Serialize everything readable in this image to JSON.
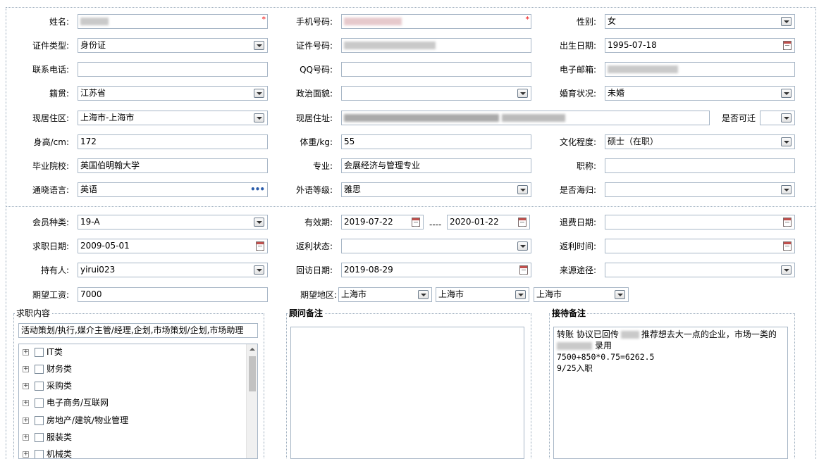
{
  "personal": {
    "name_label": "姓名:",
    "mobile_label": "手机号码:",
    "gender_label": "性别:",
    "gender_value": "女",
    "idtype_label": "证件类型:",
    "idtype_value": "身份证",
    "idno_label": "证件号码:",
    "birth_label": "出生日期:",
    "birth_value": "1995-07-18",
    "phone_label": "联系电话:",
    "qq_label": "QQ号码:",
    "email_label": "电子邮箱:",
    "native_label": "籍贯:",
    "native_value": "江苏省",
    "political_label": "政治面貌:",
    "marital_label": "婚育状况:",
    "marital_value": "未婚",
    "residence_label": "现居住区:",
    "residence_value": "上海市-上海市",
    "address_label": "现居住址:",
    "relocate_label": "是否可迁",
    "height_label": "身高/cm:",
    "height_value": "172",
    "weight_label": "体重/kg:",
    "weight_value": "55",
    "education_label": "文化程度:",
    "education_value": "硕士（在职）",
    "school_label": "毕业院校:",
    "school_value": "英国伯明翰大学",
    "major_label": "专业:",
    "major_value": "会展经济与管理专业",
    "title_label": "职称:",
    "language_label": "通晓语言:",
    "language_value": "英语",
    "forlevel_label": "外语等级:",
    "forlevel_value": "雅思",
    "overseas_label": "是否海归:"
  },
  "member": {
    "type_label": "会员种类:",
    "type_value": "19-A",
    "valid_label": "有效期:",
    "valid_from": "2019-07-22",
    "valid_sep": "----",
    "valid_to": "2020-01-22",
    "refund_date_label": "退费日期:",
    "job_date_label": "求职日期:",
    "job_date_value": "2009-05-01",
    "rebate_status_label": "返利状态:",
    "rebate_time_label": "返利时间:",
    "holder_label": "持有人:",
    "holder_value": "yirui023",
    "visit_date_label": "回访日期:",
    "visit_date_value": "2019-08-29",
    "source_label": "来源途径:",
    "salary_label": "期望工资:",
    "salary_value": "7000",
    "region_label": "期望地区:",
    "region_1": "上海市",
    "region_2": "上海市",
    "region_3": "上海市"
  },
  "job_content": {
    "title": "求职内容",
    "summary": "活动策划/执行,媒介主管/经理,企划,市场策划/企划,市场助理",
    "tree": [
      {
        "label": "IT类"
      },
      {
        "label": "财务类"
      },
      {
        "label": "采购类"
      },
      {
        "label": "电子商务/互联网"
      },
      {
        "label": "房地产/建筑/物业管理"
      },
      {
        "label": "服装类"
      },
      {
        "label": "机械类"
      }
    ],
    "expand_glyph": "+"
  },
  "advisor_note": {
    "title": "顾问备注",
    "text": ""
  },
  "reception_note": {
    "title": "接待备注",
    "line1a": "转账 协议已回传",
    "line1b": "推荐想去大一点的企业，市场一类的",
    "line2b": "录用",
    "line3": "7500+850*0.75=6262.5",
    "line4": "9/25入职"
  },
  "required_mark": "*",
  "more_glyph": "•••"
}
